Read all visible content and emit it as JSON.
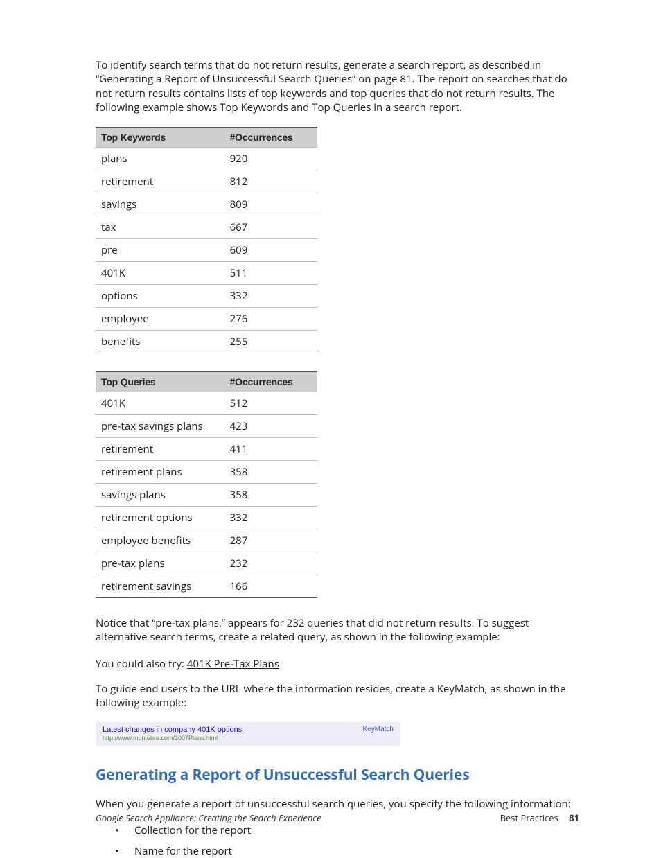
{
  "intro_para": "To identify search terms that do not return results, generate a search report, as described in “Generating a Report of Unsuccessful Search Queries” on page 81. The report on searches that do not return results contains lists of top keywords and top queries that do not return results. The following example shows Top Keywords and Top Queries in a search report.",
  "table1": {
    "header_term": "Top Keywords",
    "header_count": "#Occurrences",
    "rows": [
      {
        "term": "plans",
        "count": "920"
      },
      {
        "term": "retirement",
        "count": "812"
      },
      {
        "term": "savings",
        "count": "809"
      },
      {
        "term": "tax",
        "count": "667"
      },
      {
        "term": "pre",
        "count": "609"
      },
      {
        "term": "401K",
        "count": "511"
      },
      {
        "term": "options",
        "count": "332"
      },
      {
        "term": "employee",
        "count": "276"
      },
      {
        "term": "benefits",
        "count": "255"
      }
    ]
  },
  "table2": {
    "header_term": "Top Queries",
    "header_count": "#Occurrences",
    "rows": [
      {
        "term": "401K",
        "count": "512"
      },
      {
        "term": "pre-tax savings plans",
        "count": "423"
      },
      {
        "term": "retirement",
        "count": "411"
      },
      {
        "term": "retirement plans",
        "count": "358"
      },
      {
        "term": "savings plans",
        "count": "358"
      },
      {
        "term": "retirement options",
        "count": "332"
      },
      {
        "term": "employee benefits",
        "count": "287"
      },
      {
        "term": "pre-tax plans",
        "count": "232"
      },
      {
        "term": "retirement savings",
        "count": "166"
      }
    ]
  },
  "notice_para": "Notice that “pre-tax plans,” appears for 232 queries that did not return results. To suggest alternative search terms, create a related query, as shown in the following example:",
  "try_prefix": "You could also try: ",
  "try_link": "401K Pre-Tax Plans",
  "guide_para": "To guide end users to the URL where the information resides, create a KeyMatch, as shown in the following example:",
  "keymatch": {
    "title": "Latest changes in company 401K options",
    "url": "http://www.montebre.com/2007Plans.html",
    "label": "KeyMatch"
  },
  "section_heading": "Generating a Report of Unsuccessful Search Queries",
  "section_intro": "When you generate a report of unsuccessful search queries, you specify the following information:",
  "bullets": [
    "Collection for the report",
    "Name for the report"
  ],
  "footer": {
    "left": "Google Search Appliance: Creating the Search Experience",
    "right_label": "Best Practices",
    "page": "81"
  }
}
